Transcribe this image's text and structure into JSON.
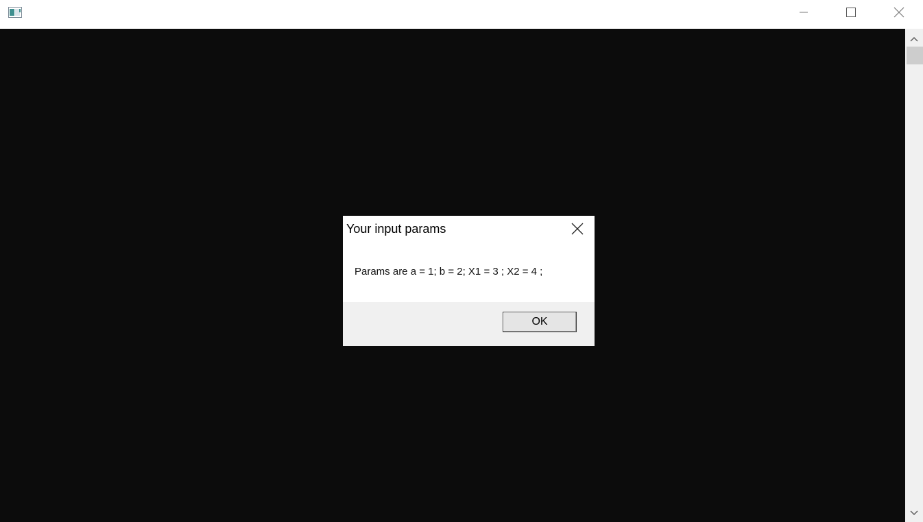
{
  "window": {
    "title": "",
    "icon": "app-window-icon",
    "controls": {
      "minimize_icon": "minimize-icon",
      "maximize_icon": "maximize-icon",
      "close_icon": "close-icon"
    },
    "client_background": "#0c0c0c"
  },
  "scrollbar": {
    "up_icon": "chevron-up-icon",
    "down_icon": "chevron-down-icon"
  },
  "dialog": {
    "title": "Your input params",
    "message": "Params are a = 1; b = 2; X1 = 3 ; X2 = 4 ;",
    "ok_label": "OK",
    "close_icon": "close-icon"
  }
}
